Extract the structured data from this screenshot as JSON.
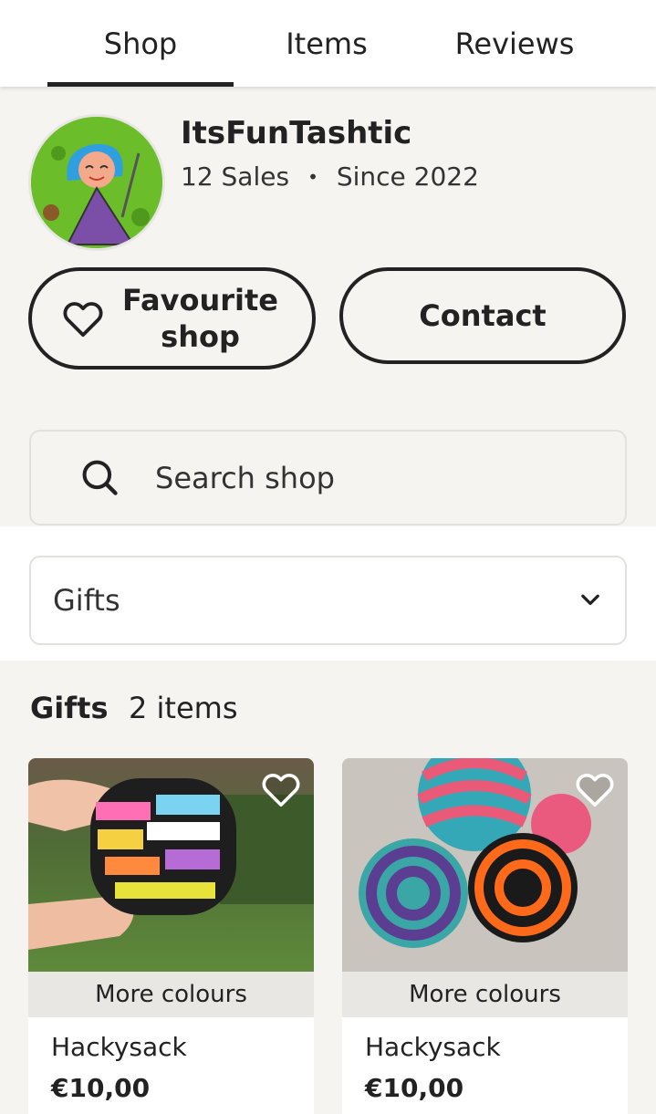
{
  "tabs": [
    {
      "label": "Shop",
      "active": true
    },
    {
      "label": "Items",
      "active": false
    },
    {
      "label": "Reviews",
      "active": false
    }
  ],
  "shop": {
    "name": "ItsFunTashtic",
    "sales": "12 Sales",
    "separator": "•",
    "since": "Since 2022",
    "avatar_icon": "shop-logo-avatar"
  },
  "actions": {
    "favourite_label": "Favourite shop",
    "favourite_icon": "heart-outline-icon",
    "contact_label": "Contact"
  },
  "search": {
    "placeholder": "Search shop",
    "icon": "search-icon"
  },
  "filter": {
    "selected": "Gifts",
    "icon": "chevron-down-icon"
  },
  "section": {
    "title": "Gifts",
    "count": "2 items"
  },
  "listings": [
    {
      "badge": "More colours",
      "title": "Hackysack",
      "price": "€10,00",
      "favourite_icon": "heart-outline-icon"
    },
    {
      "badge": "More colours",
      "title": "Hackysack",
      "price": "€10,00",
      "favourite_icon": "heart-outline-icon"
    }
  ],
  "colors": {
    "background": "#f5f4f1",
    "text": "#222222",
    "border": "#222222",
    "avatar_bg": "#6cbd2a"
  }
}
